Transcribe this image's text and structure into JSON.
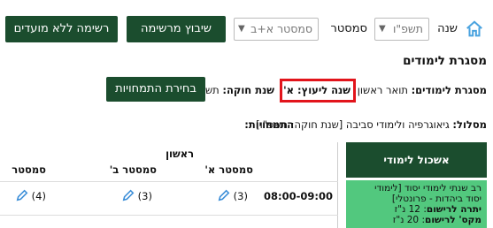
{
  "header": {
    "year_label": "שנה",
    "year_value": "תשפ\"ו",
    "semester_label": "סמסטר",
    "semester_value": "סמסטר א+ב",
    "assign_button": "שיבוץ מרשימה",
    "no_candidates_button": "רשימה ללא מועדים"
  },
  "frame": {
    "title": "מסגרת לימודים",
    "framework_label": "מסגרת לימודים:",
    "framework_value": "תואר ראשון",
    "advisory_year": "שנה ליעוץ: א'",
    "statute_year_label": "שנת חוקה:",
    "statute_year_value": "תשפ\"ו",
    "pick_specializations_button": "בחירת התמחויות",
    "track_label": "מסלול:",
    "track_value": "גיאוגרפיה ולימודי סביבה [שנת חוקה: תשפ\"ו]",
    "specializations_label": "התמחויות:"
  },
  "side_panel": {
    "title": "אשכול לימודי",
    "line1": "רב שנתי לימודי יסוד [לימודי",
    "line2": "יסוד ביהדות - פרונטלי]",
    "required_label": "יתרה לרישום",
    "required_value": ": 12 נ\"ז",
    "max_label": "מקס' לרישום",
    "max_value": ": 20 נ\"ז"
  },
  "grid": {
    "year_header": "ראשון",
    "columns": [
      "סמסטר א'",
      "סמסטר ב'",
      "סמסטר"
    ],
    "rows": [
      {
        "time": "08:00-09:00",
        "cells": [
          "(3)",
          "(3)",
          "(4)"
        ]
      }
    ]
  },
  "colors": {
    "accent_dark": "#1b4d2e",
    "accent_green": "#52c87e",
    "highlight_red": "#e2141b"
  }
}
